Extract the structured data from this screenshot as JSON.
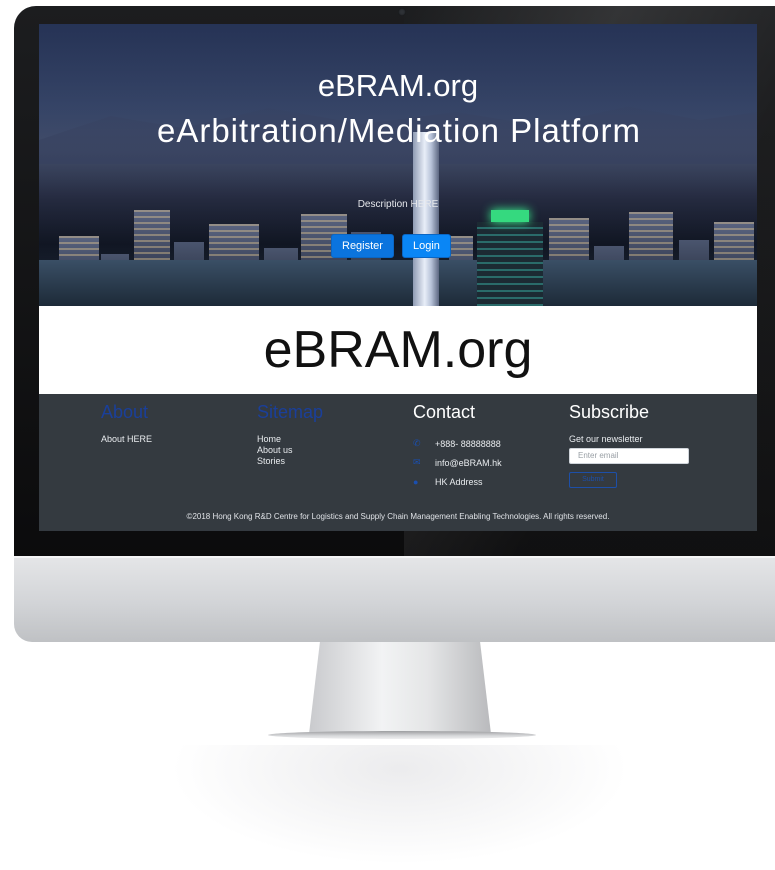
{
  "hero": {
    "site_name": "eBRAM.org",
    "title": "eArbitration/Mediation Platform",
    "description": "Description HERE",
    "register_label": "Register",
    "login_label": "Login"
  },
  "overlay": {
    "text": "eBRAM.org"
  },
  "footer": {
    "about": {
      "heading": "About",
      "text": "About HERE"
    },
    "sitemap": {
      "heading": "Sitemap",
      "links": [
        "Home",
        "About us",
        "Stories"
      ]
    },
    "contact": {
      "heading": "Contact",
      "phone": "+888- 88888888",
      "email": "info@eBRAM.hk",
      "address": "HK Address"
    },
    "subscribe": {
      "heading": "Subscribe",
      "text": "Get our newsletter",
      "email_placeholder": "Enter email",
      "submit_label": "Submit"
    },
    "copyright": "©2018 Hong Kong R&D Centre for Logistics and Supply Chain Management Enabling Technologies. All rights reserved."
  },
  "colors": {
    "primary_button": "#0b74de",
    "footer_bg": "#343a40",
    "footer_heading_blue": "#1a3f9a"
  },
  "icons": {
    "phone": "phone-icon",
    "email": "envelope-icon",
    "address": "map-marker-icon"
  }
}
